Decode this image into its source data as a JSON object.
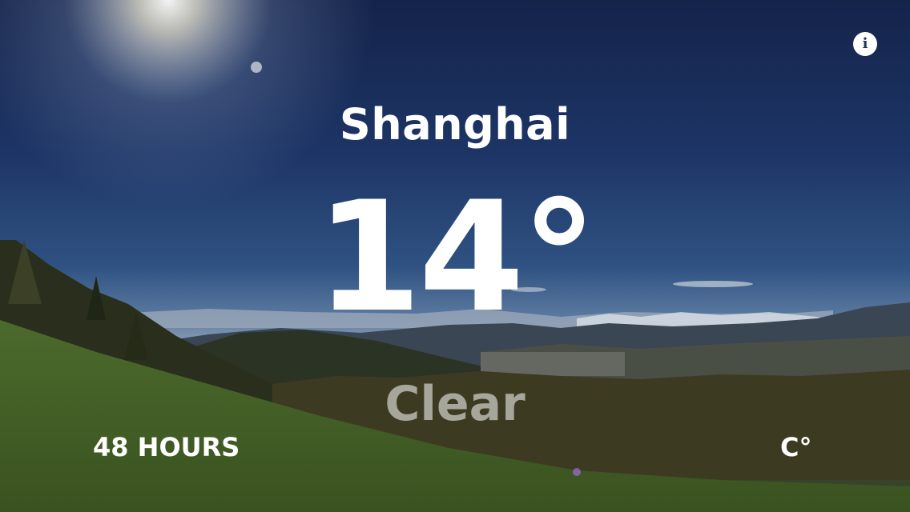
{
  "location": {
    "city": "Shanghai"
  },
  "weather": {
    "temperature": "14°",
    "condition": "Clear"
  },
  "controls": {
    "hours_label": "48 HOURS",
    "unit_label": "C°",
    "info_icon": "info-icon"
  },
  "colors": {
    "text": "#ffffff",
    "sky_top": "#14234a",
    "grass": "#4a6a2a"
  }
}
